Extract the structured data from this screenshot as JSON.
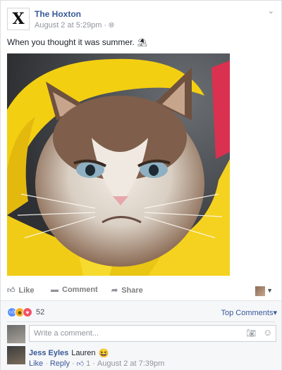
{
  "post": {
    "page_name": "The Hoxton",
    "logo_letter": "X",
    "timestamp": "August 2 at 5:29pm",
    "audience_icon": "globe-icon",
    "text": "When you thought it was summer.",
    "text_emoji": "⛱",
    "menu_icon": "chevron-down-icon"
  },
  "actions": {
    "like_label": "Like",
    "comment_label": "Comment",
    "share_label": "Share"
  },
  "reactions": {
    "count": "52",
    "top_comments_label": "Top Comments",
    "top_comments_caret": "▾"
  },
  "composer": {
    "placeholder": "Write a comment..."
  },
  "comment": {
    "author": "Jess Eyles",
    "text": "Lauren",
    "emoji": "😆",
    "like_label": "Like",
    "reply_label": "Reply",
    "like_count": "1",
    "timestamp": "August 2 at 7:39pm",
    "separator": "·"
  },
  "colors": {
    "link": "#365899",
    "meta": "#90949c",
    "raincoat_yellow": "#f5d21f",
    "like_blue": "#5890ff",
    "love_red": "#f25268",
    "haha_yellow": "#f7b125"
  }
}
